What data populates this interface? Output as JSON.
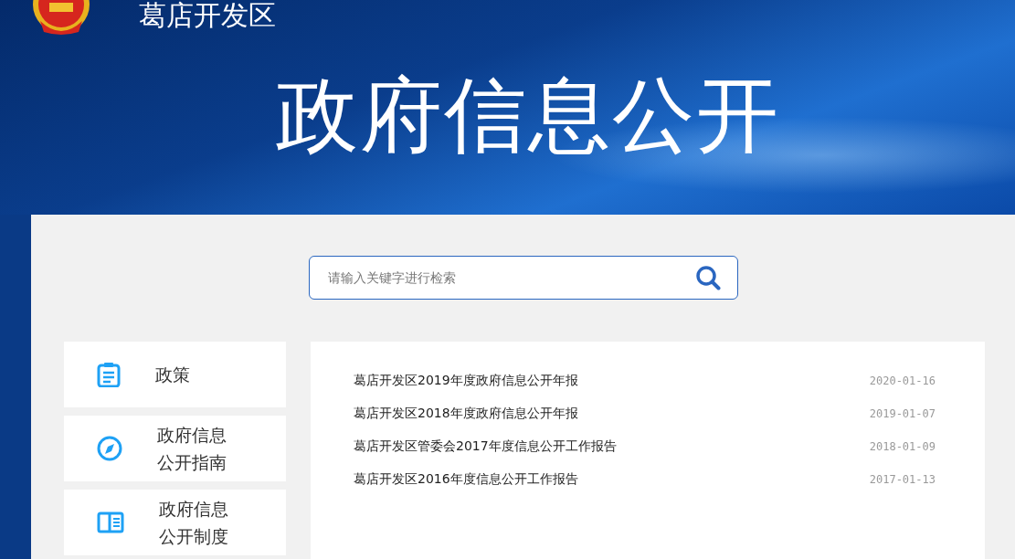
{
  "header": {
    "site_name": "葛店开发区",
    "title": "政府信息公开"
  },
  "search": {
    "placeholder": "请输入关键字进行检索"
  },
  "sidebar": {
    "items": [
      {
        "kind": "clipboard",
        "lines": [
          "政策"
        ]
      },
      {
        "kind": "compass",
        "lines": [
          "政府信息",
          "公开指南"
        ]
      },
      {
        "kind": "book",
        "lines": [
          "政府信息",
          "公开制度"
        ]
      }
    ]
  },
  "list": {
    "items": [
      {
        "title": "葛店开发区2019年度政府信息公开年报",
        "date": "2020-01-16"
      },
      {
        "title": "葛店开发区2018年度政府信息公开年报",
        "date": "2019-01-07"
      },
      {
        "title": "葛店开发区管委会2017年度信息公开工作报告",
        "date": "2018-01-09"
      },
      {
        "title": "葛店开发区2016年度信息公开工作报告",
        "date": "2017-01-13"
      }
    ]
  }
}
